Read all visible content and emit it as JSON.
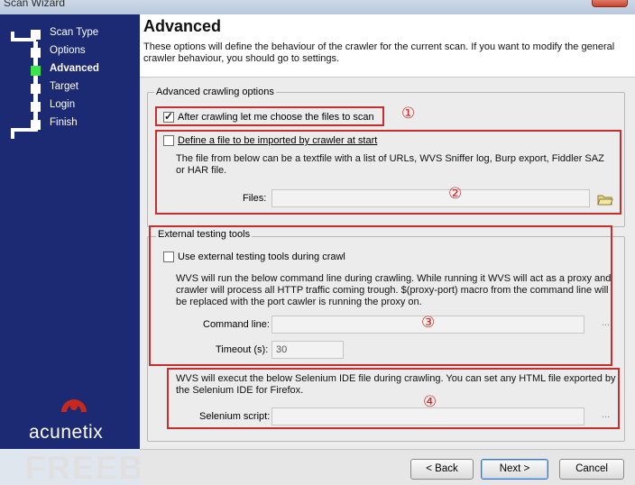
{
  "window": {
    "title": "Scan Wizard"
  },
  "steps": [
    {
      "label": "Scan Type",
      "active": false
    },
    {
      "label": "Options",
      "active": false
    },
    {
      "label": "Advanced",
      "active": true
    },
    {
      "label": "Target",
      "active": false
    },
    {
      "label": "Login",
      "active": false
    },
    {
      "label": "Finish",
      "active": false
    }
  ],
  "brand": {
    "name": "acunetix",
    "color": "#c8281e"
  },
  "header": {
    "title": "Advanced",
    "description": "These options will define the behaviour of the crawler for the current scan. If you want to modify the general crawler behaviour, you should go to settings."
  },
  "advanced_crawling": {
    "group_title": "Advanced crawling options",
    "choose_files": {
      "label": "After crawling let me choose the files to scan",
      "checked": true
    },
    "define_file": {
      "label": "Define a file to be imported by crawler at start",
      "checked": false
    },
    "file_description": "The file from below can be a textfile with a list of URLs, WVS Sniffer log, Burp export, Fiddler SAZ or HAR file.",
    "files_label": "Files:",
    "files_value": ""
  },
  "external_tools": {
    "group_title": "External testing tools",
    "use_external": {
      "label": "Use external testing tools during crawl",
      "checked": false
    },
    "description": "WVS will run the below command line during crawling. While running it WVS will act as a proxy and crawler will process all HTTP traffic coming trough. $(proxy-port) macro from the command line will be replaced with the port cawler is running the proxy on.",
    "command_line_label": "Command line:",
    "command_line_value": "",
    "timeout_label": "Timeout (s):",
    "timeout_value": "30",
    "selenium_description": "WVS will execut the below Selenium IDE file during crawling. You can set any HTML file exported by the Selenium IDE for Firefox.",
    "selenium_label": "Selenium script:",
    "selenium_value": ""
  },
  "annotations": [
    "①",
    "②",
    "③",
    "④"
  ],
  "ellipsis": "...",
  "buttons": {
    "back": "< Back",
    "next": "Next >",
    "cancel": "Cancel"
  },
  "watermark": "FREEBUF",
  "colors": {
    "sidebar": "#1c2a73",
    "active_step": "#3ee24a",
    "annotation_red": "#c92e2e"
  }
}
